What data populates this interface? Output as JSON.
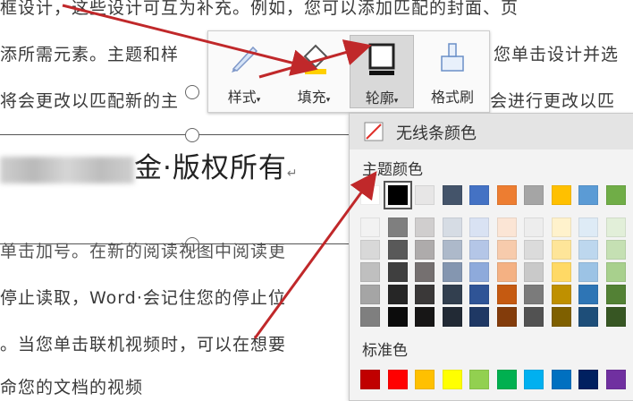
{
  "document": {
    "line1": "框设计，这些设计可互为补充。例如，您可以添加匹配的封面、页",
    "line2_left": "添所需元素。主题和样",
    "line2_right": "您单击设计并选",
    "line3_left": "将会更改以匹配新的主",
    "line3_right": "会进行更改以匹",
    "title": "金·版权所有",
    "line4": "单击加号。在新的阅读视图中阅读更",
    "line5": "停止读取，Word·会记住您的停止位",
    "line6": "。当您单击联机视频时，可以在想要",
    "line7": "命您的文档的视频"
  },
  "toolbar": {
    "style": "样式",
    "fill": "填充",
    "outline": "轮廓",
    "format_painter": "格式刷"
  },
  "dropdown": {
    "no_line": "无线条颜色",
    "theme_colors": "主题颜色",
    "standard_colors": "标准色",
    "theme_top": [
      "#ffffff",
      "#000000",
      "#e7e6e6",
      "#44546a",
      "#4472c4",
      "#ed7d31",
      "#a5a5a5",
      "#ffc000",
      "#5b9bd5",
      "#70ad47"
    ],
    "theme_shades": [
      [
        "#f2f2f2",
        "#7f7f7f",
        "#d0cece",
        "#d6dce4",
        "#d9e2f3",
        "#fbe5d5",
        "#ededed",
        "#fff2cc",
        "#deebf6",
        "#e2efd9"
      ],
      [
        "#d8d8d8",
        "#595959",
        "#aeabab",
        "#adb9ca",
        "#b4c6e7",
        "#f7cbac",
        "#dbdbdb",
        "#fee599",
        "#bdd7ee",
        "#c5e0b3"
      ],
      [
        "#bfbfbf",
        "#3f3f3f",
        "#757070",
        "#8496b0",
        "#8eaadb",
        "#f4b183",
        "#c9c9c9",
        "#ffd965",
        "#9cc3e5",
        "#a8d08d"
      ],
      [
        "#a5a5a5",
        "#262626",
        "#3a3838",
        "#323f4f",
        "#2f5496",
        "#c55a11",
        "#7b7b7b",
        "#bf9000",
        "#2e75b5",
        "#538135"
      ],
      [
        "#7f7f7f",
        "#0c0c0c",
        "#171616",
        "#222a35",
        "#1f3864",
        "#833c0b",
        "#525252",
        "#7f6000",
        "#1e4e79",
        "#375623"
      ]
    ],
    "standard": [
      "#c00000",
      "#ff0000",
      "#ffc000",
      "#ffff00",
      "#92d050",
      "#00b050",
      "#00b0f0",
      "#0070c0",
      "#002060",
      "#7030a0"
    ]
  }
}
